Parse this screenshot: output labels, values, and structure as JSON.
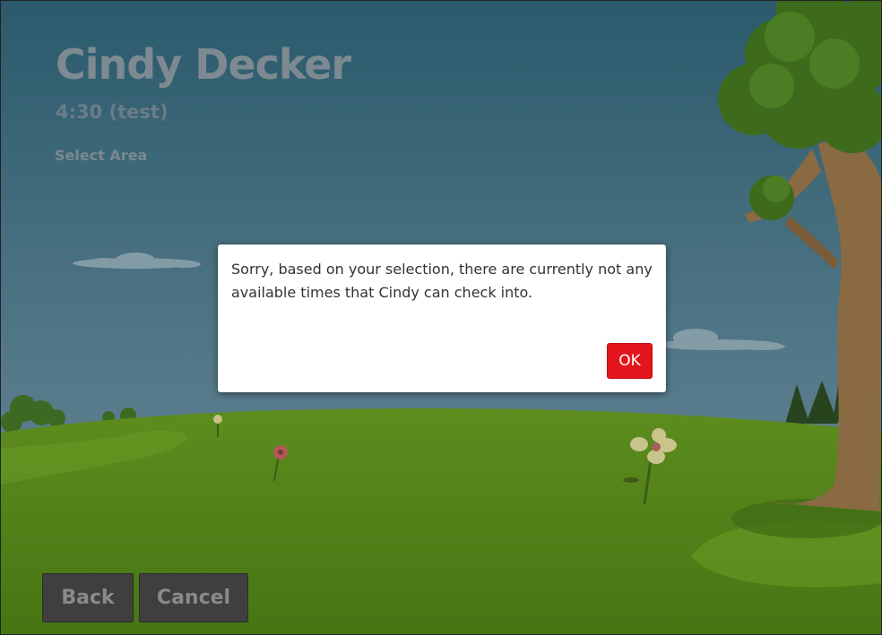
{
  "header": {
    "name": "Cindy Decker",
    "subtitle": "4:30 (test)",
    "section_label": "Select Area"
  },
  "footer": {
    "back_label": "Back",
    "cancel_label": "Cancel"
  },
  "dialog": {
    "message": "Sorry, based on your selection, there are currently not any available times that Cindy can check into.",
    "ok_label": "OK"
  },
  "colors": {
    "ok_button": "#e3141b",
    "nav_button": "#3f3f3f",
    "sky_top": "#2c5b6e",
    "grass": "#4f7d1a"
  }
}
